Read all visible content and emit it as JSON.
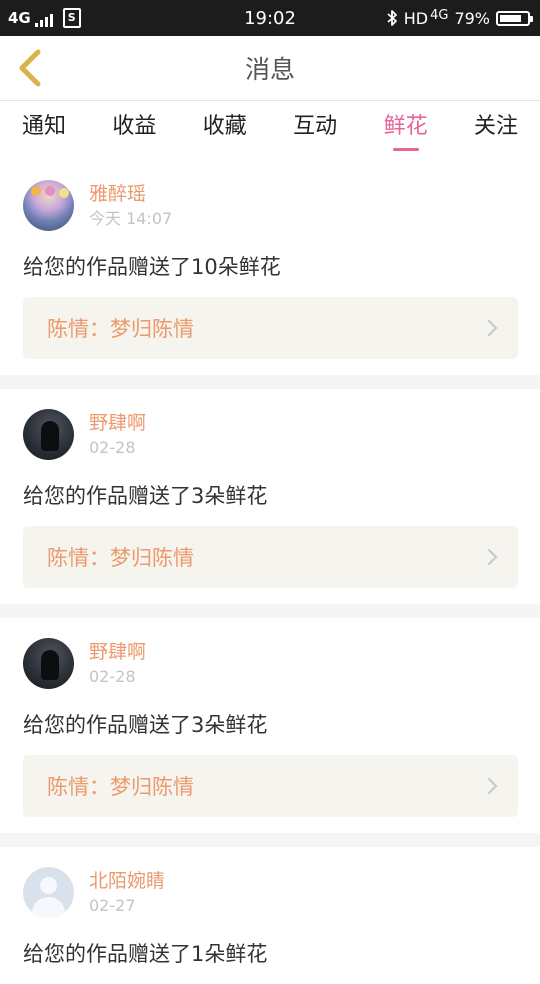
{
  "status_bar": {
    "network": "4G",
    "sim_label": "S",
    "time": "19:02",
    "hd_label": "HD",
    "lte_label": "4G",
    "battery_text": "79%",
    "battery_level": 0.79
  },
  "header": {
    "title": "消息",
    "back_icon": "chevron-left-icon"
  },
  "tabs": [
    {
      "label": "通知"
    },
    {
      "label": "收益"
    },
    {
      "label": "收藏"
    },
    {
      "label": "互动"
    },
    {
      "label": "鲜花",
      "active": true
    },
    {
      "label": "关注"
    }
  ],
  "notifications": [
    {
      "username": "雅醉瑶",
      "time": "今天 14:07",
      "message": "给您的作品赠送了10朵鲜花",
      "work": "陈情：梦归陈情"
    },
    {
      "username": "野肆啊",
      "time": "02-28",
      "message": "给您的作品赠送了3朵鲜花",
      "work": "陈情：梦归陈情"
    },
    {
      "username": "野肆啊",
      "time": "02-28",
      "message": "给您的作品赠送了3朵鲜花",
      "work": "陈情：梦归陈情"
    },
    {
      "username": "北陌婉睛",
      "time": "02-27",
      "message": "给您的作品赠送了1朵鲜花",
      "work": ""
    }
  ],
  "colors": {
    "accent_pink": "#e8649a",
    "username_orange": "#ec9a6d",
    "back_arrow": "#d9b24a"
  }
}
